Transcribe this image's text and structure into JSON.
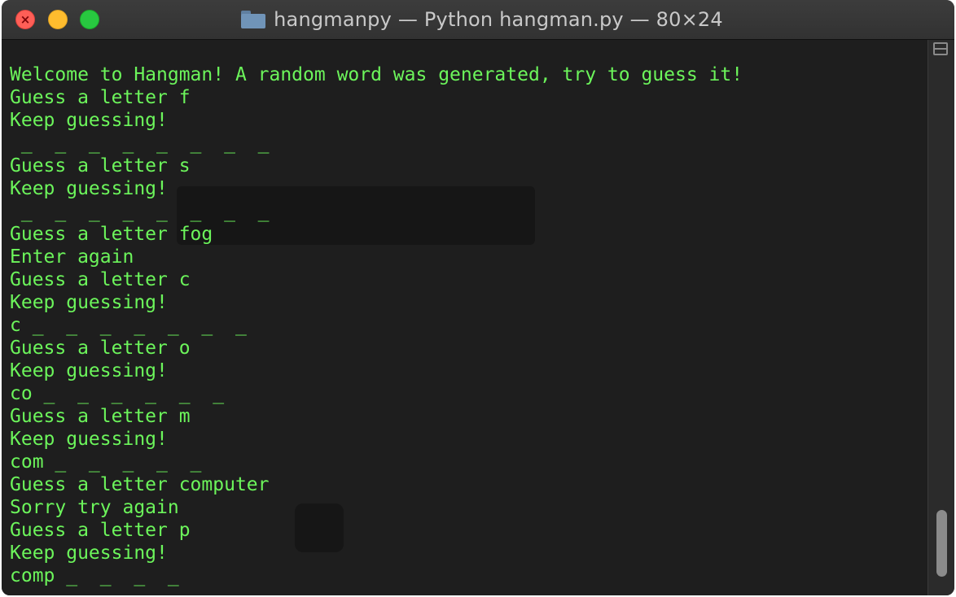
{
  "window": {
    "title": "hangmanpy — Python hangman.py — 80×24",
    "icons": {
      "close": "close-icon",
      "minimize": "minimize-icon",
      "maximize": "maximize-icon",
      "folder": "folder-icon",
      "split": "split-view-icon"
    },
    "colors": {
      "background": "#1e1e1e",
      "text": "#6cf55b",
      "titlebar": "#3a3a3a"
    }
  },
  "terminal": {
    "lines": [
      "Welcome to Hangman! A random word was generated, try to guess it!",
      "Guess a letter f",
      "Keep guessing!",
      " _  _  _  _  _  _  _  _",
      "Guess a letter s",
      "Keep guessing!",
      " _  _  _  _  _  _  _  _",
      "Guess a letter fog",
      "Enter again",
      "Guess a letter c",
      "Keep guessing!",
      "c _  _  _  _  _  _  _",
      "Guess a letter o",
      "Keep guessing!",
      "co _  _  _  _  _  _",
      "Guess a letter m",
      "Keep guessing!",
      "com _  _  _  _  _",
      "Guess a letter computer",
      "Sorry try again",
      "Guess a letter p",
      "Keep guessing!",
      "comp _  _  _  _"
    ]
  }
}
